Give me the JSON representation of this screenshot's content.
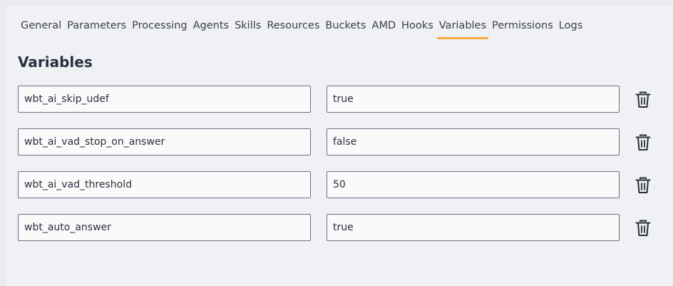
{
  "tabs": [
    "General",
    "Parameters",
    "Processing",
    "Agents",
    "Skills",
    "Resources",
    "Buckets",
    "AMD",
    "Hooks",
    "Variables",
    "Permissions",
    "Logs"
  ],
  "active_tab": "Variables",
  "accent_color": "#f3a93c",
  "section_title": "Variables",
  "variables": [
    {
      "name": "wbt_ai_skip_udef",
      "value": "true"
    },
    {
      "name": "wbt_ai_vad_stop_on_answer",
      "value": "false"
    },
    {
      "name": "wbt_ai_vad_threshold",
      "value": "50"
    },
    {
      "name": "wbt_auto_answer",
      "value": "true"
    }
  ],
  "row_action_icon": "trash-icon"
}
